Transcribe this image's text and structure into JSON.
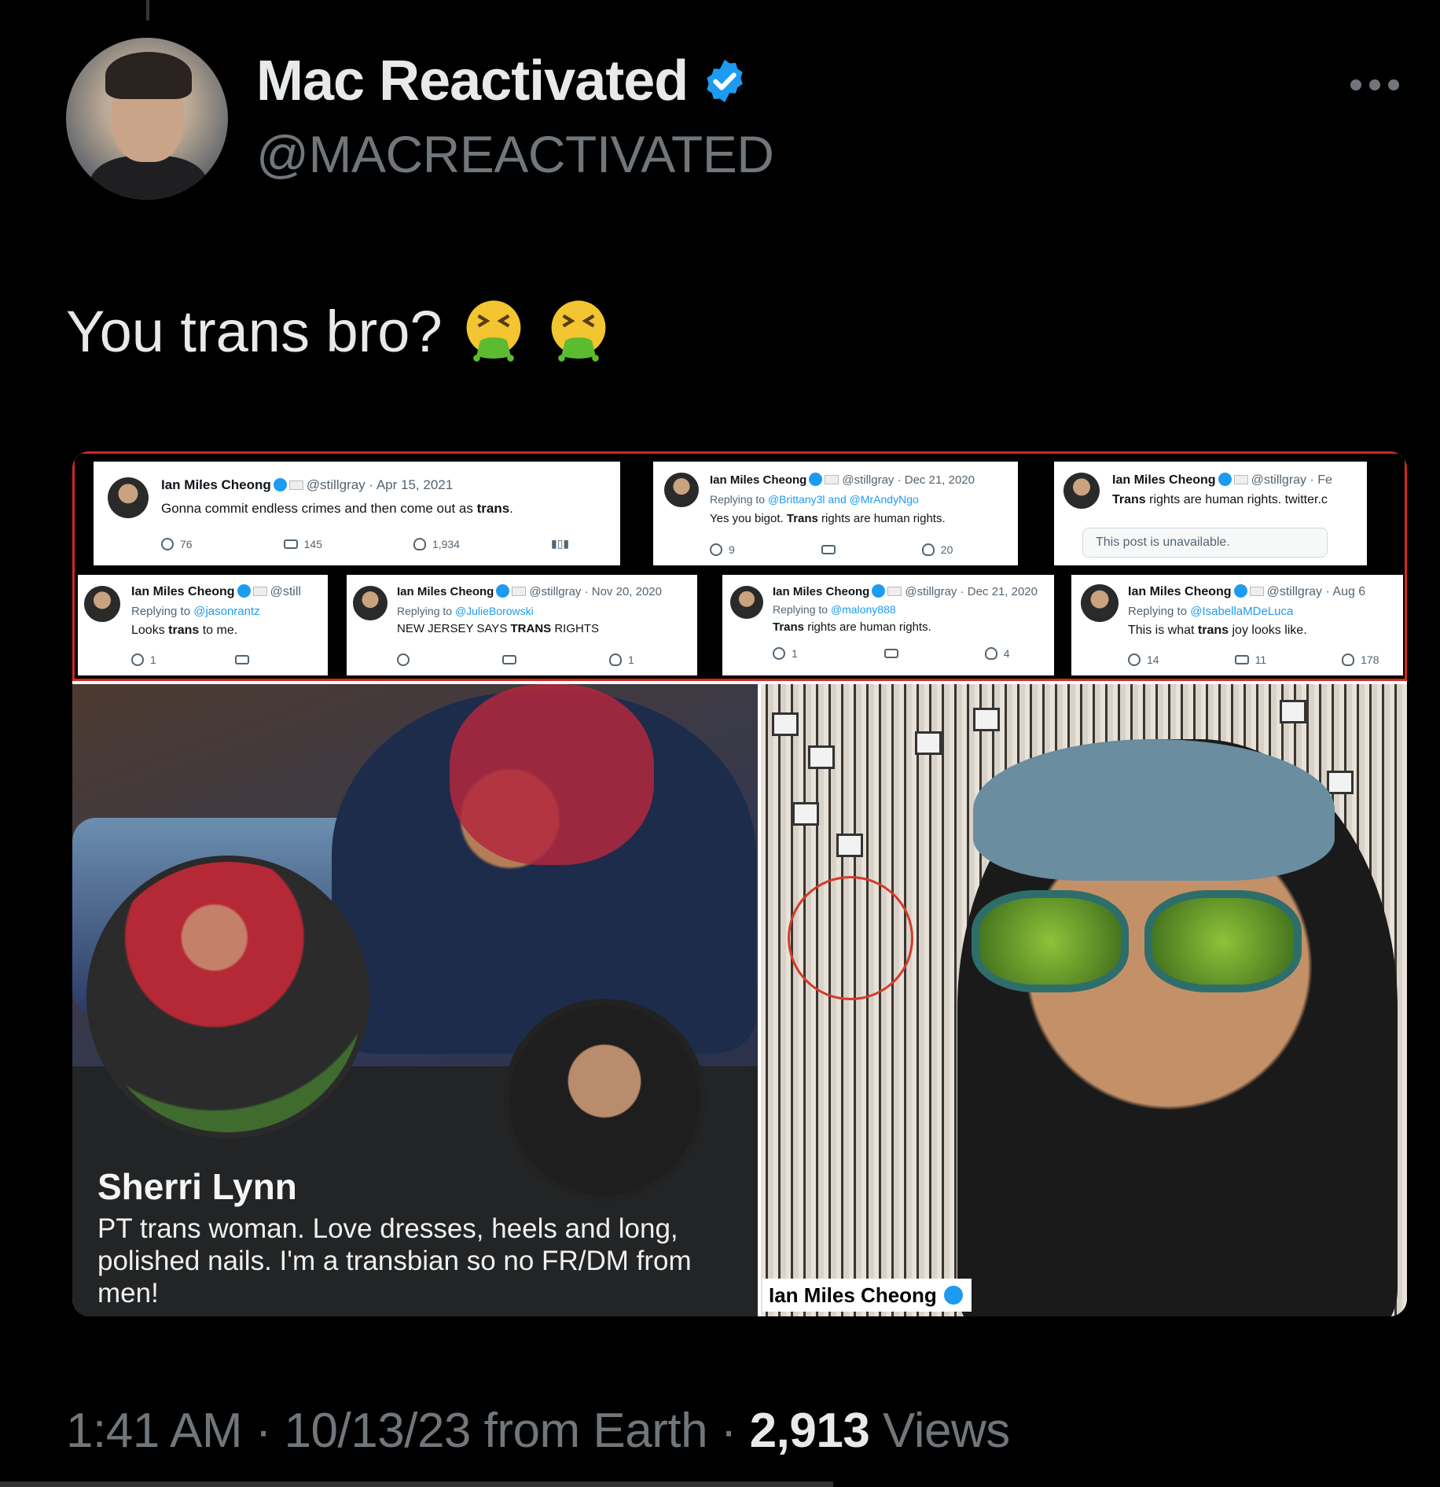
{
  "author": {
    "display_name": "Mac Reactivated",
    "handle": "@MACREACTIVATED",
    "verified": true
  },
  "tweet": {
    "text": "You trans bro?",
    "emojis": [
      "face-vomiting-emoji",
      "face-vomiting-emoji"
    ]
  },
  "media": {
    "screenshot_cards": [
      {
        "name": "Ian Miles Cheong",
        "meta": "@stillgray · Apr 15, 2021",
        "reply_to": "",
        "body_pre": "Gonna commit endless crimes and then come out as ",
        "body_bold": "trans",
        "body_post": ".",
        "replies": "76",
        "reposts": "145",
        "likes": "1,934"
      },
      {
        "name": "Ian Miles Cheong",
        "meta": "@stillgray · Dec 21, 2020",
        "reply_to": "@Brittany3l and @MrAndyNgo",
        "body_pre": "Yes you bigot. ",
        "body_bold": "Trans",
        "body_post": " rights are human rights.",
        "replies": "9",
        "reposts": "",
        "likes": "20"
      },
      {
        "name": "Ian Miles Cheong",
        "meta": "@stillgray · Fe",
        "reply_to": "",
        "body_pre": "",
        "body_bold": "Trans",
        "body_post": " rights are human rights. twitter.c",
        "unavailable": "This post is unavailable."
      },
      {
        "name": "Ian Miles Cheong",
        "meta": "@still",
        "reply_to": "@jasonrantz",
        "body_pre": "Looks ",
        "body_bold": "trans",
        "body_post": " to me.",
        "replies": "1",
        "reposts": "",
        "likes": ""
      },
      {
        "name": "Ian Miles Cheong",
        "meta": "@stillgray · Nov 20, 2020",
        "reply_to": "@JulieBorowski",
        "body_pre": "NEW JERSEY SAYS ",
        "body_bold": "TRANS",
        "body_post": " RIGHTS",
        "replies": "",
        "reposts": "",
        "likes": "1"
      },
      {
        "name": "Ian Miles Cheong",
        "meta": "@stillgray · Dec 21, 2020",
        "reply_to": "@malony888",
        "body_pre": "",
        "body_bold": "Trans",
        "body_post": " rights are human rights.",
        "replies": "1",
        "reposts": "",
        "likes": "4"
      },
      {
        "name": "Ian Miles Cheong",
        "meta": "@stillgray · Aug 6",
        "reply_to": "@IsabellaMDeLuca",
        "body_pre": "This is what ",
        "body_bold": "trans",
        "body_post": " joy looks like.",
        "replies": "14",
        "reposts": "11",
        "likes": "178"
      }
    ],
    "replying_to_label": "Replying to ",
    "profile": {
      "name": "Sherri Lynn",
      "bio": "PT trans woman. Love dresses, heels and long, polished nails. I'm a transbian so no FR/DM from men!"
    },
    "photo_label": "Ian Miles Cheong"
  },
  "footer": {
    "time_date": "1:41 AM · 10/13/23 from Earth · ",
    "views_count": "2,913",
    "views_label": " Views"
  },
  "colors": {
    "background": "#000000",
    "text_primary": "#e7e9ea",
    "text_secondary": "#71767b",
    "verified_blue": "#1d9bf0",
    "highlight_red": "#d2281f"
  }
}
